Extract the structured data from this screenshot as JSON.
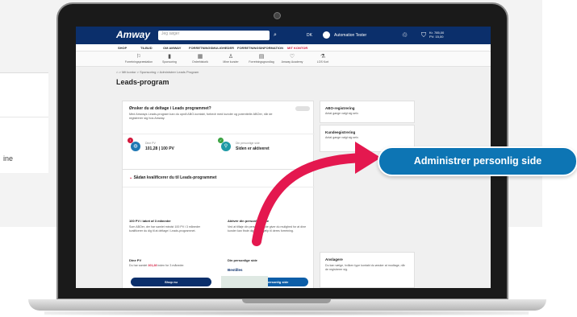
{
  "background": {
    "fragment_text": "ine"
  },
  "site": {
    "logo": "Amway",
    "search_placeholder": "Jeg søger",
    "lang": "DK",
    "user_name": "Automation Tester",
    "cart_line1": "Kr. 785,00",
    "cart_line2": "PV: 15,00"
  },
  "nav": [
    {
      "label": "SHOP",
      "active": false
    },
    {
      "label": "TILBUD",
      "active": false
    },
    {
      "label": "OM AMWAY",
      "active": false
    },
    {
      "label": "FORRETNINGSMULIGHEDER",
      "active": false
    },
    {
      "label": "FORRETNINGSINFORMATION",
      "active": false
    },
    {
      "label": "MIT KONTOR",
      "active": true
    }
  ],
  "subnav": [
    {
      "icon": "⚐",
      "label": "Forretningspræstation"
    },
    {
      "icon": "▮",
      "label": "Sponsoring"
    },
    {
      "icon": "▦",
      "label": "Ordrehistorik"
    },
    {
      "icon": "♙",
      "label": "Mine kunder"
    },
    {
      "icon": "▤",
      "label": "Forretningsgrundlag"
    },
    {
      "icon": "♡",
      "label": "Amway Academy"
    },
    {
      "icon": "⚗",
      "label": "LOS Kort"
    }
  ],
  "breadcrumb": "⌂ > Mit kontor > Sponsoring > Administrer Leads Program",
  "page_title": "Leads-program",
  "main_card": {
    "title": "Ønsker du at deltage i Leads programmet?",
    "desc": "Med Amways Leads-program kan du opnå ABO-kontakt, forbedr med kunder og potentielle ABOer, når de registrerer sig hos Amway.",
    "kpi1_label": "Dine PV",
    "kpi1_value": "101,28 | 100 PV",
    "kpi2_label": "Din personlige side",
    "kpi2_value": "Siden er aktiveret"
  },
  "section": {
    "title": "Sådan kvalificerer du til Leads-programmet",
    "col1_title": "100 PV i løbet af 3 måneder",
    "col1_desc": "Som ABOer, der har samlet mindst 100 PV i 3 måneder kvalificerer du dig til at deltage i Leads-programmet.",
    "col2_title": "Aktivér din personlige side",
    "col2_desc": "Ved at tilføje din personlige side giver du mulighed for at dine kunder kan finde dig og få hjælp til deres forretning.",
    "pv_title": "Dine PV",
    "pv_desc_prefix": "Du har samlet",
    "pv_value": "101,28",
    "pv_desc_suffix": "inden for 3 måneder.",
    "col2b_title": "Din personlige side",
    "col2b_status": "Bestilles",
    "shop_label": "Shop nu",
    "admin_small_label": "Administrer personlig side"
  },
  "side": {
    "card1_title": "ABO-registrering",
    "card1_desc": "Antal gange valgt sig selv.",
    "card2_title": "Kundeegistrering",
    "card2_desc": "Antal gange valgt sig selv.",
    "card3_title": "Anslagere",
    "card3_desc": "Du kan vælge, hvilken type kontakt du ønsker at modtage, når de registrerer sig."
  },
  "callout_label": "Administrer personlig side",
  "colors": {
    "brand_navy": "#0b2f6b",
    "accent_red": "#d2163a",
    "callout_blue": "#0d75b4",
    "arrow": "#e4184f"
  }
}
